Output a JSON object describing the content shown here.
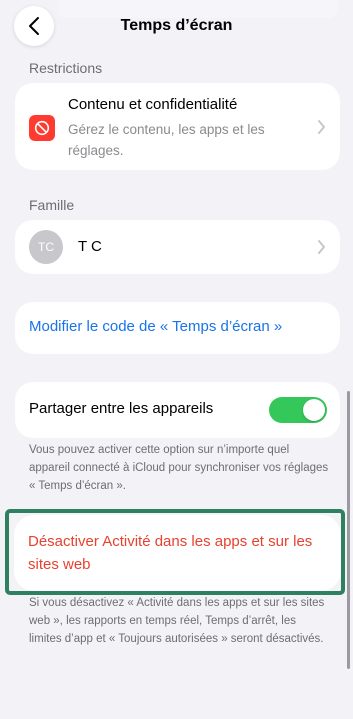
{
  "nav": {
    "title": "Temps d’écran",
    "back_icon": "chevron-left-icon"
  },
  "restrictions": {
    "header": "Restrictions",
    "item_title": "Contenu et confidentialité",
    "item_subtitle": "Gérez le contenu, les apps et les réglages.",
    "icon": "no-entry-icon",
    "icon_color": "#ff3b30"
  },
  "family": {
    "header": "Famille",
    "member_initials": "TC",
    "member_name": "T C"
  },
  "passcode": {
    "link_label": "Modifier le code de « Temps d’écran »",
    "link_color": "#1a73e8"
  },
  "sharing": {
    "label": "Partager entre les appareils",
    "toggle_on": true,
    "toggle_color": "#34c759",
    "footer": "Vous pouvez activer cette option sur n’importe quel appareil connecté à iCloud pour synchroniser vos réglages « Temps d’écran »."
  },
  "deactivate": {
    "label": "Désactiver Activité dans les apps et sur les sites web",
    "color": "#e8412f",
    "highlight_color": "#2f8060",
    "footer": "Si vous désactivez « Activité dans les apps et sur les sites web », les rapports en temps réel, Temps d’arrêt, les limites d’app et « Toujours autorisées » seront désactivés."
  }
}
